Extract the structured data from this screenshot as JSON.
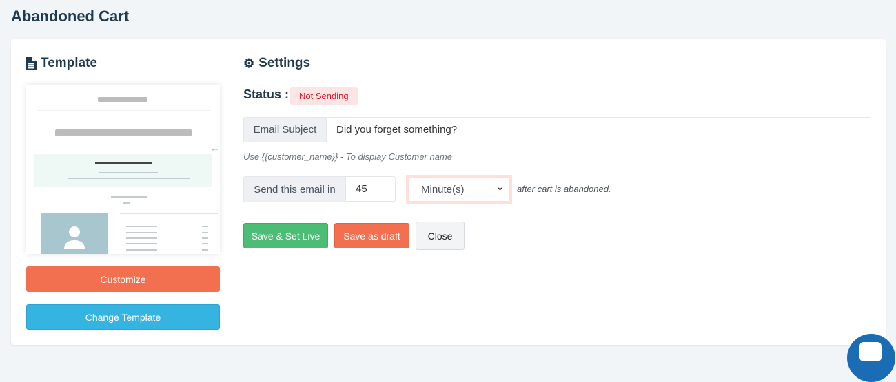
{
  "page": {
    "title": "Abandoned Cart"
  },
  "template": {
    "heading": "Template",
    "customize_label": "Customize",
    "change_label": "Change Template"
  },
  "settings": {
    "heading": "Settings",
    "status_label": "Status :",
    "status_value": "Not Sending",
    "subject_label": "Email Subject",
    "subject_value": "Did you forget something?",
    "subject_hint": "Use {{customer_name}} - To display Customer name",
    "delay_label": "Send this email in",
    "delay_value": "45",
    "delay_unit": "Minute(s)",
    "delay_suffix": "after cart is abandoned.",
    "save_live_label": "Save & Set Live",
    "save_draft_label": "Save as draft",
    "close_label": "Close"
  },
  "colors": {
    "green": "#4cbd74",
    "orange": "#f26f50",
    "blue": "#35b4e2",
    "badge_text": "#e8141c",
    "chat": "#1a6db5"
  }
}
